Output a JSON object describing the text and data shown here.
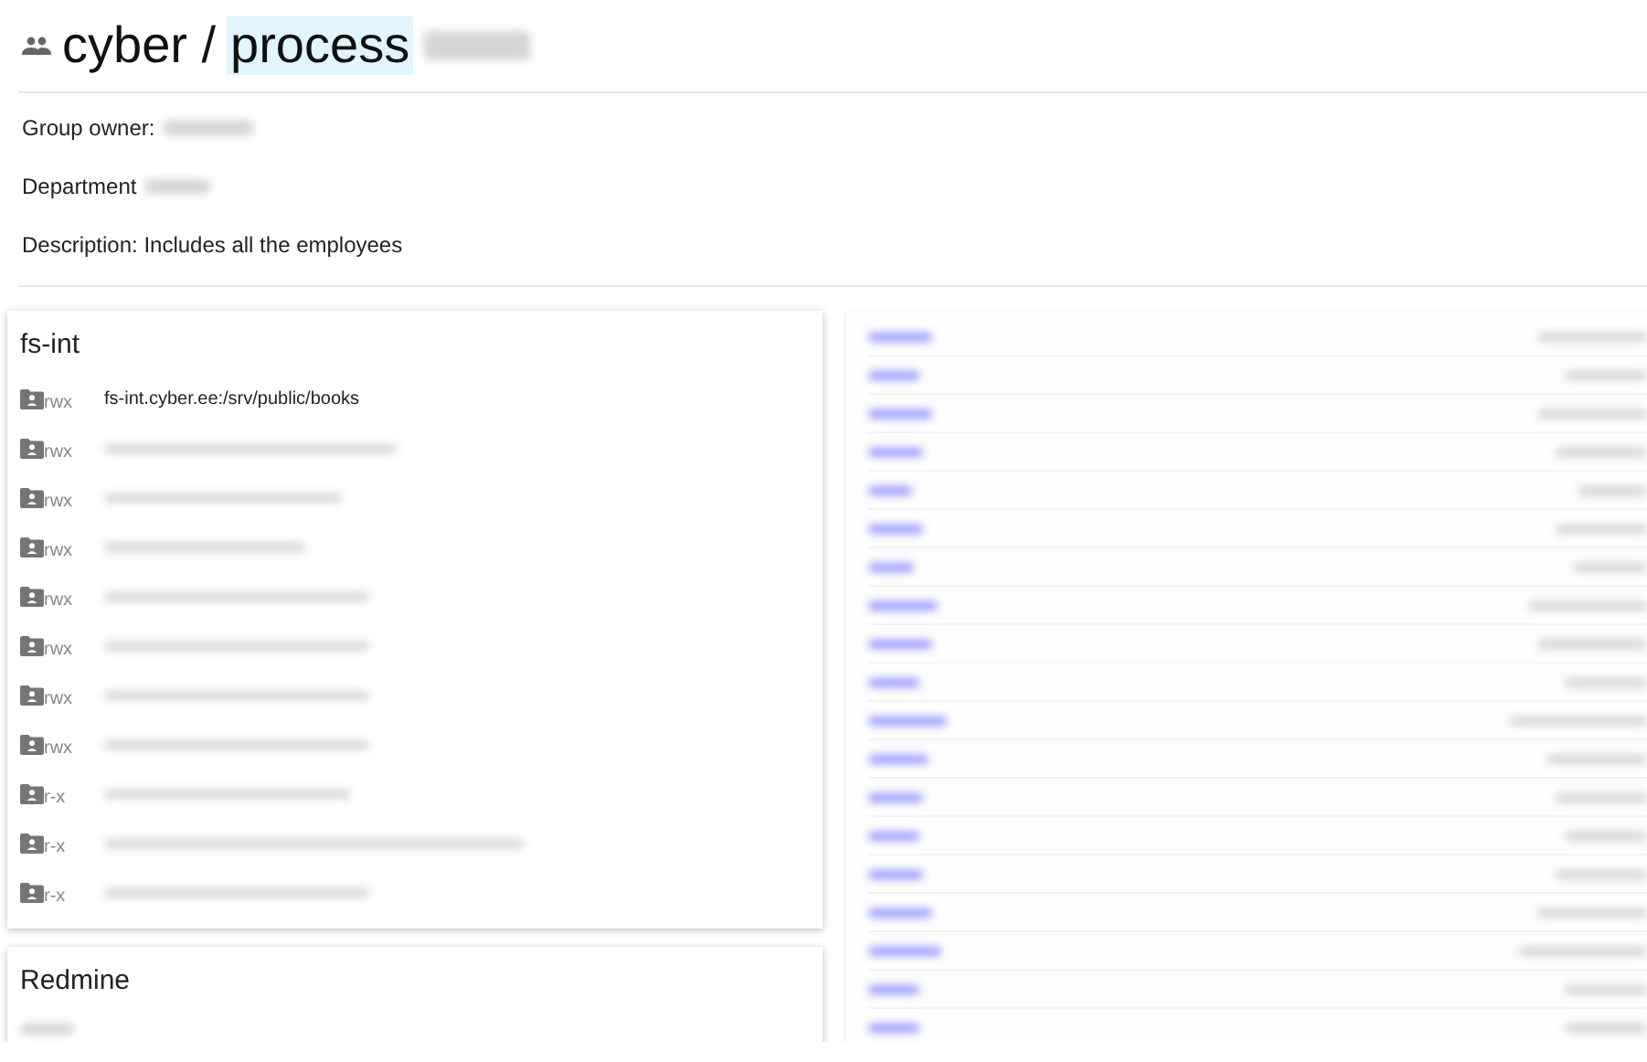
{
  "header": {
    "group": "cyber",
    "separator": "/",
    "name": "process",
    "name_highlighted": true,
    "suffix_redacted": true
  },
  "details": [
    {
      "label": "Group owner:",
      "redacted": true
    },
    {
      "label": "Department",
      "redacted": true
    },
    {
      "label": "Description: Includes all the employees",
      "redacted": false
    }
  ],
  "cards": [
    {
      "title": "fs-int",
      "folders": [
        {
          "permission": "rwx",
          "path": "fs-int.cyber.ee:/srv/public/books",
          "redacted": false
        },
        {
          "permission": "rwx",
          "redacted": true
        },
        {
          "permission": "rwx",
          "redacted": true
        },
        {
          "permission": "rwx",
          "redacted": true
        },
        {
          "permission": "rwx",
          "redacted": true
        },
        {
          "permission": "rwx",
          "redacted": true
        },
        {
          "permission": "rwx",
          "redacted": true
        },
        {
          "permission": "rwx",
          "redacted": true
        },
        {
          "permission": "r-x",
          "redacted": true
        },
        {
          "permission": "r-x",
          "redacted": true
        },
        {
          "permission": "r-x",
          "redacted": true
        }
      ]
    },
    {
      "title": "Redmine",
      "content_redacted": true
    }
  ],
  "members": [
    {
      "redacted": true
    },
    {
      "redacted": true
    },
    {
      "redacted": true
    },
    {
      "redacted": true
    },
    {
      "redacted": true
    },
    {
      "redacted": true
    },
    {
      "redacted": true
    },
    {
      "redacted": true
    },
    {
      "redacted": true
    },
    {
      "redacted": true
    },
    {
      "redacted": true
    },
    {
      "redacted": true
    },
    {
      "redacted": true
    },
    {
      "redacted": true
    },
    {
      "redacted": true
    },
    {
      "redacted": true
    },
    {
      "redacted": true
    },
    {
      "redacted": true
    },
    {
      "redacted": true
    }
  ]
}
